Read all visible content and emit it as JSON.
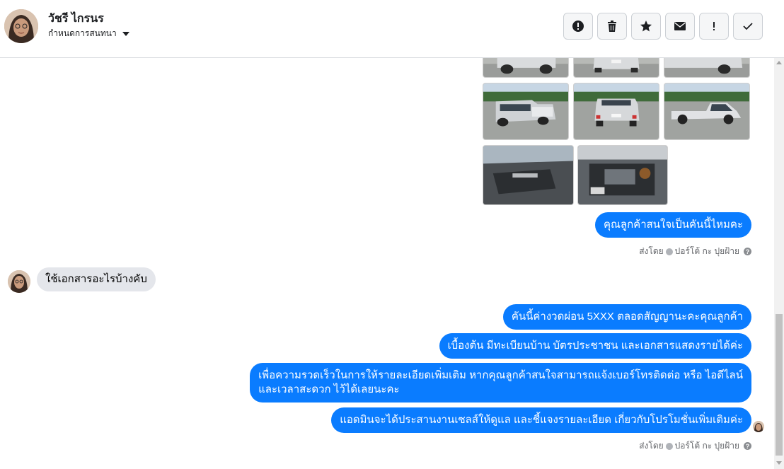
{
  "header": {
    "contact_name": "วัชรี ไกรนร",
    "assign_label": "กำหนดการสนทนา",
    "actions": [
      {
        "name": "spam-button",
        "icon": "alert-circle-icon"
      },
      {
        "name": "delete-button",
        "icon": "trash-icon"
      },
      {
        "name": "star-button",
        "icon": "star-icon"
      },
      {
        "name": "mark-unread-button",
        "icon": "envelope-icon"
      },
      {
        "name": "follow-up-button",
        "icon": "exclamation-icon"
      },
      {
        "name": "mark-done-button",
        "icon": "checkmark-icon"
      }
    ]
  },
  "thread": {
    "photo_icons": [
      "truck-front-photo",
      "truck-rear-photo",
      "truck-side-photo",
      "door-panel-photo",
      "engine-bay-photo"
    ],
    "messages": {
      "out_1": "คุณลูกค้าสนใจเป็นคันนี้ไหมคะ",
      "in_1": "ใช้เอกสารอะไรบ้างคับ",
      "out_2": "คันนี้ค่างวดผ่อน 5XXX ตลอดสัญญานะคะคุณลูกค้า",
      "out_3": "เบื้องต้น มีทะเบียนบ้าน บัตรประชาชน และเอกสารแสดงรายได้ค่ะ",
      "out_4": "เพื่อความรวดเร็วในการให้รายละเอียดเพิ่มเติม หากคุณลูกค้าสนใจสามารถแจ้งเบอร์โทรติดต่อ หรือ ไอดีไลน์\nและเวลาสะดวก ไว้ได้เลยนะคะ",
      "out_5": "แอดมินจะได้ประสานงานเซลส์ให้ดูแล และชี้แจงรายละเอียด เกี่ยวกับโปรโมชั่นเพิ่มเติมค่ะ"
    },
    "sent_by_label": "ส่งโดย",
    "sent_by_name": "ปอร์โต้ กะ ปุยฝ้าย",
    "help_glyph": "?"
  },
  "colors": {
    "outgoing_bubble": "#0a7cff",
    "incoming_bubble": "#e4e6eb",
    "meta_text": "#65676b"
  }
}
